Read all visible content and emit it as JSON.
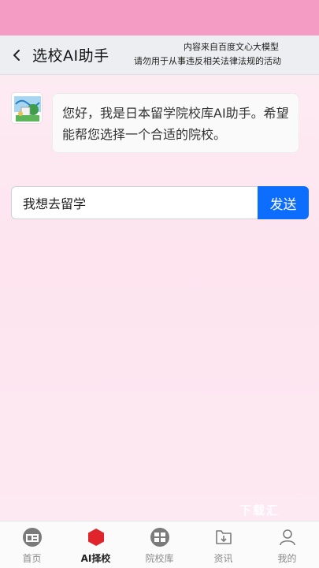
{
  "header": {
    "title": "选校AI助手",
    "disclaimer_line1": "内容来自百度文心大模型",
    "disclaimer_line2": "请勿用于从事违反相关法律法规的活动"
  },
  "chat": {
    "bot_message": "您好，我是日本留学院校库AI助手。希望能帮您选择一个合适的院校。",
    "input_value": "我想去留学",
    "send_label": "发送"
  },
  "watermark": "下载汇",
  "tabs": [
    {
      "label": "首页",
      "icon": "home-icon"
    },
    {
      "label": "AI择校",
      "icon": "ai-select-icon",
      "active": true
    },
    {
      "label": "院校库",
      "icon": "school-library-icon"
    },
    {
      "label": "资讯",
      "icon": "news-icon"
    },
    {
      "label": "我的",
      "icon": "profile-icon"
    }
  ],
  "colors": {
    "status_bar": "#f59cc4",
    "send_button": "#0d6efd",
    "active_tab_icon": "#e0242b"
  }
}
